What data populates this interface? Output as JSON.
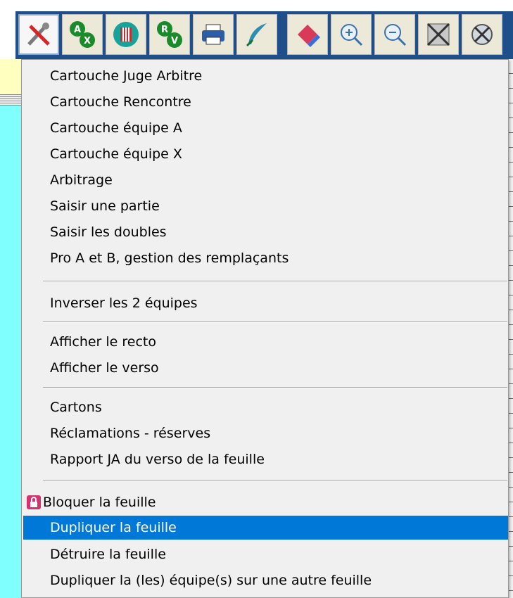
{
  "toolbar": {
    "buttons": [
      {
        "icon": "tools-icon",
        "pressed": true
      },
      {
        "icon": "swap-ax-icon"
      },
      {
        "icon": "team-icon"
      },
      {
        "icon": "swap-rv-icon"
      },
      {
        "icon": "print-icon"
      },
      {
        "icon": "feather-icon"
      },
      {
        "icon": "eraser-icon"
      },
      {
        "icon": "zoom-in-icon"
      },
      {
        "icon": "zoom-out-icon"
      },
      {
        "icon": "cross-grid-icon"
      },
      {
        "icon": "cancel-icon"
      }
    ]
  },
  "menu": {
    "group1": [
      "Cartouche Juge Arbitre",
      "Cartouche Rencontre",
      "Cartouche équipe A",
      "Cartouche équipe X",
      "Arbitrage",
      "Saisir une partie",
      "Saisir les doubles",
      "Pro A et B, gestion des remplaçants"
    ],
    "group2": [
      "Inverser les 2 équipes"
    ],
    "group3": [
      "Afficher le recto",
      "Afficher le verso"
    ],
    "group4": [
      "Cartons",
      "Réclamations - réserves",
      "Rapport JA du verso de la feuille"
    ],
    "group5": [
      {
        "label": "Bloquer la feuille",
        "icon": "lock-icon"
      },
      {
        "label": "Dupliquer la feuille",
        "highlighted": true
      },
      {
        "label": "Détruire la feuille"
      },
      {
        "label": "Dupliquer la (les) équipe(s) sur une autre feuille"
      }
    ]
  },
  "colors": {
    "highlight": "#0078d7",
    "toolbar_bg": "#1e4f8a",
    "side_cyan": "#80ffff",
    "side_yellow": "#ffffc0"
  }
}
